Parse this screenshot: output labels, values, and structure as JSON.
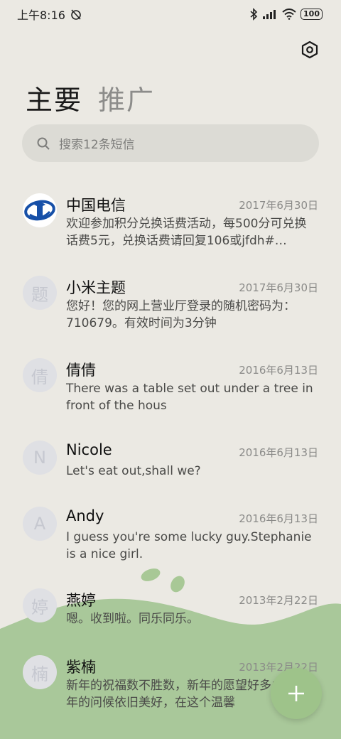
{
  "status_bar": {
    "time": "上午8:16",
    "battery": "100"
  },
  "tabs": [
    {
      "label": "主要"
    },
    {
      "label": "推广"
    }
  ],
  "search": {
    "placeholder": "搜索12条短信"
  },
  "conversations": [
    {
      "name": "中国电信",
      "date": "2017年6月30日",
      "preview": "欢迎参加积分兑换话费活动，每500分可兑换话费5元，兑换话费请回复106或jfdh#…",
      "avatar": "telecom-logo"
    },
    {
      "name": "小米主题",
      "date": "2017年6月30日",
      "preview": "您好！您的网上营业厅登录的随机密码为：710679。有效时间为3分钟",
      "avatar": "题"
    },
    {
      "name": "倩倩",
      "date": "2016年6月13日",
      "preview": "There was a table set out under a tree in front of the hous",
      "avatar": "倩"
    },
    {
      "name": "Nicole",
      "date": "2016年6月13日",
      "preview": "Let's eat out,shall we?",
      "avatar": "N"
    },
    {
      "name": "Andy",
      "date": "2016年6月13日",
      "preview": "I guess you're some lucky guy.Stephanie is a nice girl.",
      "avatar": "A"
    },
    {
      "name": "燕婷",
      "date": "2013年2月22日",
      "preview": "嗯。收到啦。同乐同乐。",
      "avatar": "婷"
    },
    {
      "name": "紫楠",
      "date": "2013年2月22日",
      "preview": "新年的祝福数不胜数，新年的愿望好多多，新年的问候依旧美好，在这个温馨",
      "avatar": "楠"
    }
  ],
  "colors": {
    "background": "#ebe9e3",
    "accent_green": "#9ec38a",
    "telecom_blue": "#1750a8"
  },
  "icons": {
    "settings": "settings-hexagon-icon",
    "search": "search-icon",
    "compose": "plus-icon"
  }
}
